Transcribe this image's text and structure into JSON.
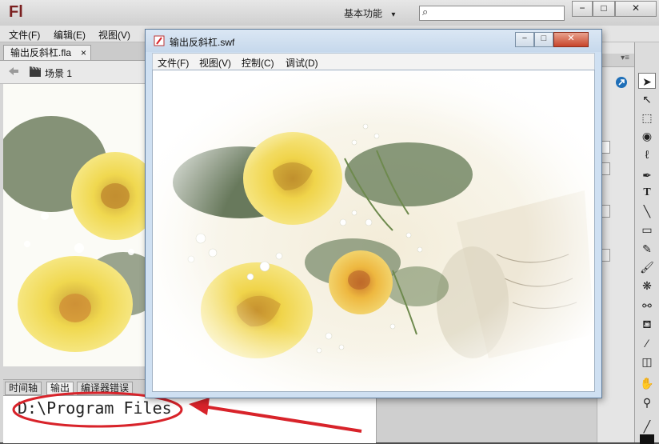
{
  "ide": {
    "logo": "Fl",
    "workspace_label": "基本功能",
    "workspace_arrow": "▾",
    "search_icon": "⌕",
    "minimize": "−",
    "maximize": "□",
    "close": "✕",
    "menu": [
      "文件(F)",
      "编辑(E)",
      "视图(V)"
    ],
    "doc_tab_label": "输出反斜杠.fla",
    "doc_tab_close": "×",
    "scene_label": "场景 1",
    "bottom_tabs": [
      "时间轴",
      "输出",
      "编译器错误"
    ],
    "output_text": "D:\\Program Files"
  },
  "swf": {
    "title": "输出反斜杠.swf",
    "menu": [
      "文件(F)",
      "视图(V)",
      "控制(C)",
      "调试(D)"
    ],
    "minimize": "−",
    "maximize": "□",
    "close": "✕"
  },
  "tools": [
    "arrow-tool-icon",
    "subselect-tool-icon",
    "free-transform-icon",
    "3d-rotation-icon",
    "lasso-icon",
    "pen-icon",
    "text-tool-icon",
    "line-tool-icon",
    "rectangle-tool-icon",
    "pencil-icon",
    "brush-icon",
    "deco-icon",
    "bone-icon",
    "paint-bucket-icon",
    "eyedropper-icon",
    "eraser-icon",
    "hand-icon",
    "zoom-icon"
  ],
  "colors": {
    "annotation_red": "#d8232a",
    "accent_blue": "#1f6fb8"
  }
}
